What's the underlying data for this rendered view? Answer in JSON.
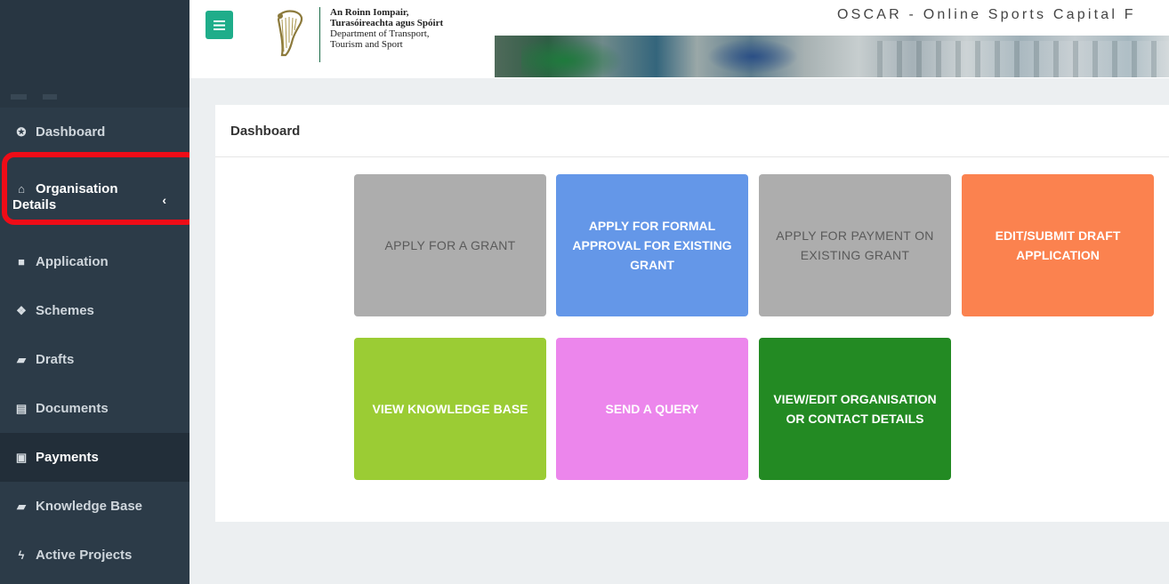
{
  "header": {
    "dept_line1": "An Roinn Iompair,",
    "dept_line2": "Turasóireachta agus Spóirt",
    "dept_line3": "Department of Transport,",
    "dept_line4": "Tourism and Sport",
    "app_title": "OSCAR - Online Sports Capital F"
  },
  "sidebar": {
    "items": [
      {
        "label": "Dashboard",
        "icon": "tachometer-icon"
      },
      {
        "label_line1": "Organisation",
        "label_line2": "Details",
        "icon": "home-icon"
      },
      {
        "label": "Application",
        "icon": "folder-icon"
      },
      {
        "label": "Schemes",
        "icon": "cubes-icon"
      },
      {
        "label": "Drafts",
        "icon": "folder-open-icon"
      },
      {
        "label": "Documents",
        "icon": "file-text-icon"
      },
      {
        "label": "Payments",
        "icon": "cc-icon"
      },
      {
        "label": "Knowledge Base",
        "icon": "book-icon"
      },
      {
        "label": "Active Projects",
        "icon": "bolt-icon"
      }
    ],
    "highlight_color": "#ef0c17"
  },
  "main": {
    "title": "Dashboard",
    "tiles": [
      {
        "label": "APPLY FOR A GRANT",
        "color": "#adadad"
      },
      {
        "label": "APPLY FOR FORMAL APPROVAL FOR EXISTING GRANT",
        "color": "#6497e8"
      },
      {
        "label": "APPLY FOR PAYMENT ON EXISTING GRANT",
        "color": "#adadad"
      },
      {
        "label": "EDIT/SUBMIT DRAFT APPLICATION",
        "color": "#fb824f"
      },
      {
        "label": "VIEW KNOWLEDGE BASE",
        "color": "#9bcc34"
      },
      {
        "label": "SEND A QUERY",
        "color": "#ec86ec"
      },
      {
        "label": "VIEW/EDIT ORGANISATION OR CONTACT DETAILS",
        "color": "#238a23"
      }
    ]
  },
  "colors": {
    "sidebar_bg": "#2c3b48",
    "menu_button": "#1fad8a",
    "content_bg": "#eceff1"
  }
}
